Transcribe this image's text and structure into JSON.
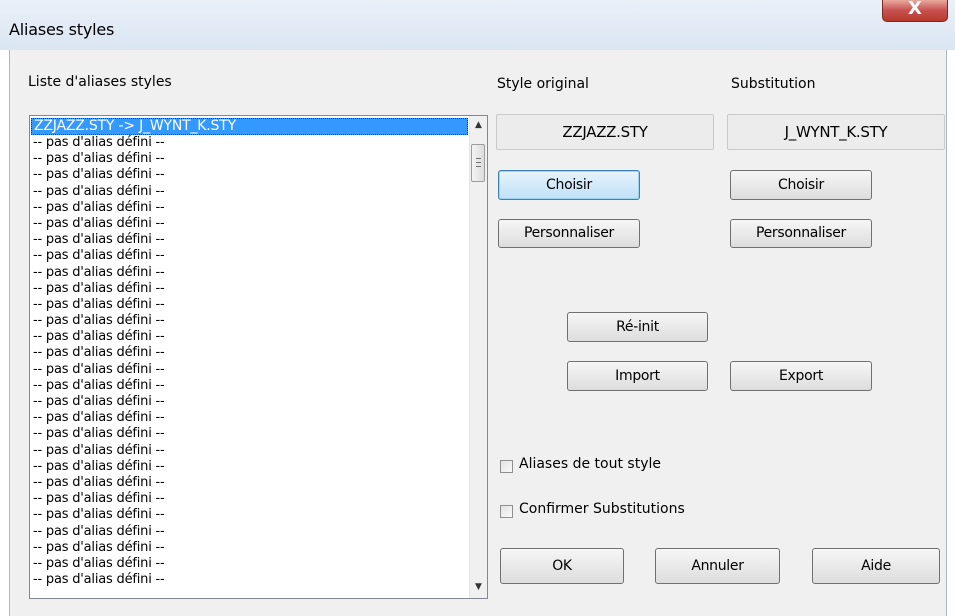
{
  "window": {
    "title": "Aliases styles",
    "close_glyph": "X"
  },
  "list": {
    "label": "Liste d'aliases styles",
    "items": [
      "ZZJAZZ.STY -> J_WYNT_K.STY",
      "-- pas d'alias défini --",
      "-- pas d'alias défini --",
      "-- pas d'alias défini --",
      "-- pas d'alias défini --",
      "-- pas d'alias défini --",
      "-- pas d'alias défini --",
      "-- pas d'alias défini --",
      "-- pas d'alias défini --",
      "-- pas d'alias défini --",
      "-- pas d'alias défini --",
      "-- pas d'alias défini --",
      "-- pas d'alias défini --",
      "-- pas d'alias défini --",
      "-- pas d'alias défini --",
      "-- pas d'alias défini --",
      "-- pas d'alias défini --",
      "-- pas d'alias défini --",
      "-- pas d'alias défini --",
      "-- pas d'alias défini --",
      "-- pas d'alias défini --",
      "-- pas d'alias défini --",
      "-- pas d'alias défini --",
      "-- pas d'alias défini --",
      "-- pas d'alias défini --",
      "-- pas d'alias défini --",
      "-- pas d'alias défini --",
      "-- pas d'alias défini --",
      "-- pas d'alias défini --"
    ],
    "selected_index": 0
  },
  "original": {
    "label": "Style original",
    "value": "ZZJAZZ.STY",
    "choose": "Choisir",
    "customize": "Personnaliser"
  },
  "substitution": {
    "label": "Substitution",
    "value": "J_WYNT_K.STY",
    "choose": "Choisir",
    "customize": "Personnaliser"
  },
  "actions": {
    "reset": "Ré-init",
    "import": "Import",
    "export": "Export"
  },
  "options": {
    "alias_any_style": {
      "label": "Aliases de tout style",
      "checked": false
    },
    "confirm_substitutions": {
      "label": "Confirmer Substitutions",
      "checked": false
    }
  },
  "footer": {
    "ok": "OK",
    "cancel": "Annuler",
    "help": "Aide"
  }
}
